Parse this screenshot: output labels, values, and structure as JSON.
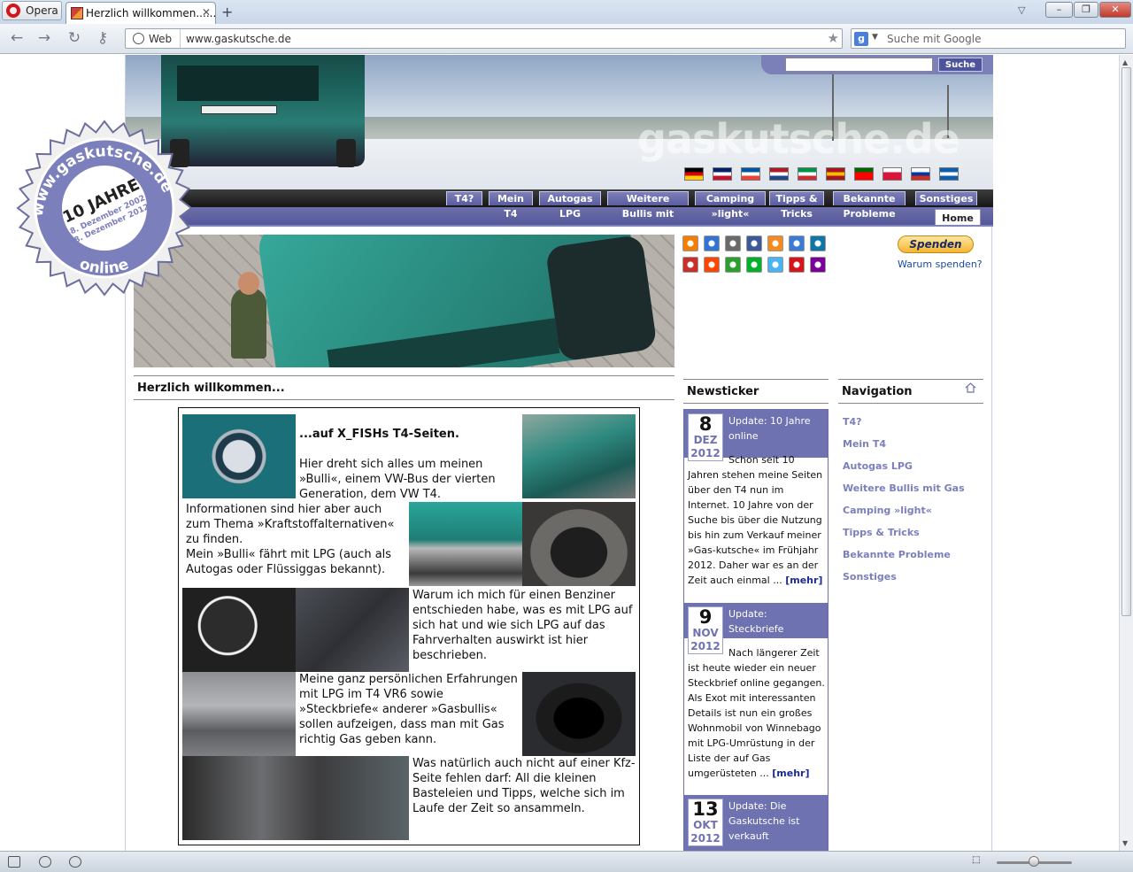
{
  "browser": {
    "menu_label": "Opera",
    "tab_title": "Herzlich willkommen......",
    "web_label": "Web",
    "url": "www.gaskutsche.de",
    "search_placeholder": "Suche mit Google",
    "google_letter": "g"
  },
  "site": {
    "logo_text": "gaskutsche.de",
    "search_button": "Suche",
    "badge": {
      "url_text": "www.gaskutsche.de",
      "years": "10 JAHRE",
      "date_line1": "8. Dezember 2002",
      "date_line2": "8. Dezember 2012",
      "online": "online"
    },
    "flags": [
      {
        "name": "german-flag",
        "colors": [
          "#000000",
          "#dd0000",
          "#ffce00"
        ]
      },
      {
        "name": "uk-flag",
        "colors": [
          "#012169",
          "#ffffff",
          "#c8102e"
        ]
      },
      {
        "name": "french-flag",
        "colors": [
          "#0055a4",
          "#ffffff",
          "#ef4135"
        ]
      },
      {
        "name": "dutch-flag",
        "colors": [
          "#ae1c28",
          "#ffffff",
          "#21468b"
        ]
      },
      {
        "name": "italian-flag",
        "colors": [
          "#009246",
          "#ffffff",
          "#ce2b37"
        ]
      },
      {
        "name": "spanish-flag",
        "colors": [
          "#aa151b",
          "#f1bf00",
          "#aa151b"
        ]
      },
      {
        "name": "portuguese-flag",
        "colors": [
          "#006600",
          "#ff0000",
          "#ff0000"
        ]
      },
      {
        "name": "polish-flag",
        "colors": [
          "#ffffff",
          "#dc143c",
          "#dc143c"
        ]
      },
      {
        "name": "russian-flag",
        "colors": [
          "#ffffff",
          "#0039a6",
          "#d52b1e"
        ]
      },
      {
        "name": "greek-flag",
        "colors": [
          "#0d5eaf",
          "#ffffff",
          "#0d5eaf"
        ]
      }
    ],
    "menu": [
      {
        "top": "T4?",
        "bottom": ""
      },
      {
        "top": "Mein",
        "bottom": "T4"
      },
      {
        "top": "Autogas",
        "bottom": "LPG"
      },
      {
        "top": "Weitere",
        "bottom": "Bullis mit"
      },
      {
        "top": "Camping",
        "bottom": "»light«"
      },
      {
        "top": "Tipps &",
        "bottom": "Tricks"
      },
      {
        "top": "Bekannte",
        "bottom": "Probleme"
      },
      {
        "top": "Sonstiges",
        "bottom": ""
      }
    ],
    "home_tab": "Home",
    "spenden": "Spenden",
    "warum": "Warum spenden?",
    "welcome_heading": "Herzlich willkommen...",
    "intro": {
      "p1_title": "...auf X_FISHs T4-Seiten.",
      "p1_text": "Hier dreht sich alles um meinen »Bulli«, einem VW-Bus der vierten Generation, dem VW T4.",
      "p2_text": "Informationen sind hier aber auch zum Thema »Kraftstoffalternativen« zu finden.",
      "p3_text": "Mein »Bulli« fährt mit LPG (auch als Autogas oder Flüssiggas bekannt).",
      "p4_text": "Warum ich mich für einen Benziner entschieden habe, was es mit LPG auf sich hat und wie sich LPG auf das Fahrverhalten auswirkt ist hier beschrieben.",
      "p5_text": "Meine ganz persönlichen Erfahrungen mit LPG im T4 VR6 sowie »Steckbriefe« anderer »Gasbullis« sollen aufzeigen, dass man mit Gas richtig Gas geben kann.",
      "p6_text": "Was natürlich auch nicht auf einer Kfz-Seite fehlen darf: All die kleinen Basteleien und Tipps, welche sich im Laufe der Zeit so ansammeln."
    },
    "newsticker": {
      "heading": "Newsticker",
      "items": [
        {
          "day": "8",
          "month": "DEZ",
          "year": "2012",
          "title": "Update: 10 Jahre online",
          "body": "Schon seit 10 Jahren stehen meine Seiten über den T4 nun im Internet. 10 Jahre von der Suche bis über die Nutzung bis hin zum Verkauf meiner »Gas-kutsche« im Frühjahr 2012. Daher war es an der Zeit auch einmal ...",
          "more": "[mehr]"
        },
        {
          "day": "9",
          "month": "NOV",
          "year": "2012",
          "title": "Update: Steckbriefe",
          "body": "Nach längerer Zeit ist heute wieder ein neuer Steckbrief online gegangen. Als Exot mit interessanten Details ist nun ein großes Wohnmobil von Winnebago mit LPG-Umrüstung in der Liste der auf Gas umgerüsteten ...",
          "more": "[mehr]"
        },
        {
          "day": "13",
          "month": "OKT",
          "year": "2012",
          "title": "Update: Die Gaskutsche ist verkauft",
          "body": "",
          "more": ""
        }
      ]
    },
    "navigation": {
      "heading": "Navigation",
      "links": [
        "T4?",
        "Mein T4",
        "Autogas LPG",
        "Weitere Bullis mit Gas",
        "Camping »light«",
        "Tipps & Tricks",
        "Bekannte Probleme",
        "Sonstiges"
      ]
    }
  },
  "colors": {
    "accent": "#6e72b0",
    "link": "#7b7fbb",
    "more": "#1b2a99"
  }
}
